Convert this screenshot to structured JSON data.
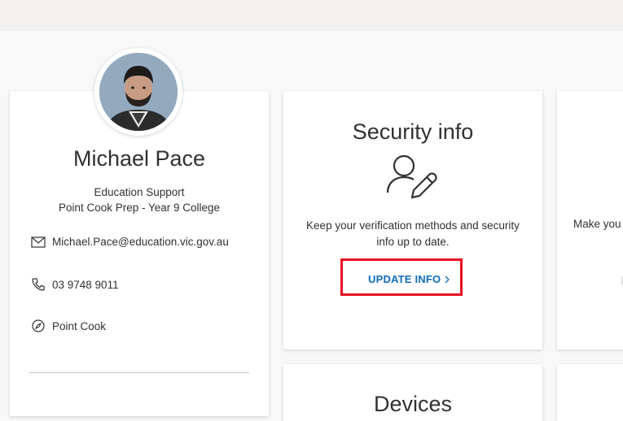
{
  "profile": {
    "name": "Michael Pace",
    "role": "Education Support",
    "organization": "Point Cook Prep - Year 9 College",
    "email": "Michael.Pace@education.vic.gov.au",
    "phone": "03 9748 9011",
    "location": "Point Cook"
  },
  "security": {
    "title": "Security info",
    "description_line1": "Keep your verification methods and security",
    "description_line2": "info up to date.",
    "link_label": "UPDATE INFO"
  },
  "next_card": {
    "description": "Make you"
  },
  "devices": {
    "title": "Devices"
  },
  "colors": {
    "link": "#0f6cbd",
    "highlight": "#e81123"
  }
}
